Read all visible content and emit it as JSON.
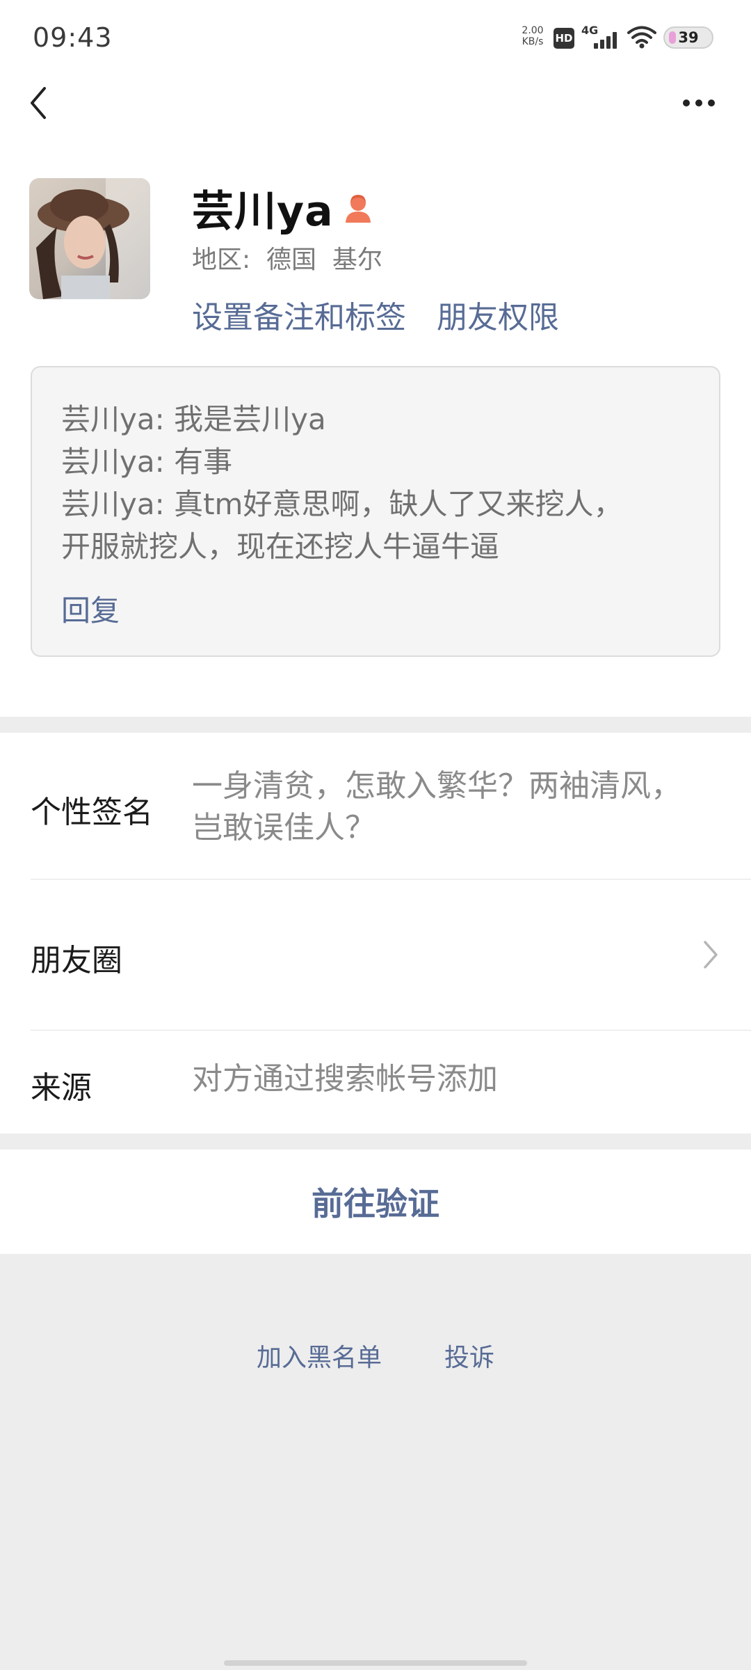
{
  "status_bar": {
    "time": "09:43",
    "net_speed_value": "2.00",
    "net_speed_unit": "KB/s",
    "hd_label": "HD",
    "network_label": "4G",
    "battery": "39"
  },
  "profile": {
    "nickname": "芸川ya",
    "region": "地区:  德国  基尔",
    "links": [
      "设置备注和标签",
      "朋友权限"
    ]
  },
  "greeting": {
    "messages": [
      "芸川ya: 我是芸川ya",
      "芸川ya: 有事",
      "芸川ya: 真tm好意思啊，缺人了又来挖人，",
      "开服就挖人，现在还挖人牛逼牛逼"
    ],
    "reply_label": "回复"
  },
  "info": {
    "signature_label": "个性签名",
    "signature_lines": [
      "一身清贫，怎敢入繁华？两袖清风，",
      "岂敢误佳人？"
    ],
    "moments_label": "朋友圈",
    "source_label": "来源",
    "source_value": "对方通过搜索帐号添加"
  },
  "actions": {
    "verify_label": "前往验证",
    "blacklist_label": "加入黑名单",
    "report_label": "投诉"
  },
  "colors": {
    "link": "#576b95",
    "gender_female": "#f07a5a",
    "background": "#ededed"
  },
  "icons": {
    "back": "back-arrow-icon",
    "more": "more-dots-icon",
    "gender": "female-icon",
    "chevron": "chevron-right-icon",
    "wifi": "wifi-icon"
  }
}
